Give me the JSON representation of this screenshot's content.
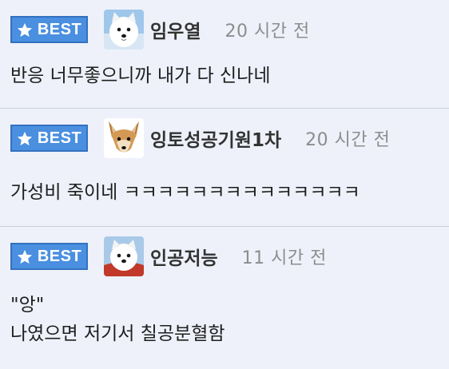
{
  "comments": [
    {
      "badge": "BEST",
      "avatar": "white-dog-avatar",
      "nickname": "임우열",
      "time": "20 시간 전",
      "lines": [
        "반응 너무좋으니까 내가 다 신나네"
      ]
    },
    {
      "badge": "BEST",
      "avatar": "shiba-dog-avatar",
      "nickname": "잉토성공기원1차",
      "time": "20 시간 전",
      "lines": [
        "가성비 죽이네 ㅋㅋㅋㅋㅋㅋㅋㅋㅋㅋㅋㅋㅋㅋ"
      ]
    },
    {
      "badge": "BEST",
      "avatar": "white-dog-red-avatar",
      "nickname": "인공저능",
      "time": "11 시간 전",
      "lines": [
        "\"앙\"",
        "나였으면 저기서 칠공분혈함"
      ]
    }
  ],
  "colors": {
    "background": "#eef1fa",
    "badge": "#4a8fe0",
    "divider": "#c9ceda",
    "time": "#8d8d8d"
  },
  "icons": {
    "badge_icon": "star-icon"
  }
}
